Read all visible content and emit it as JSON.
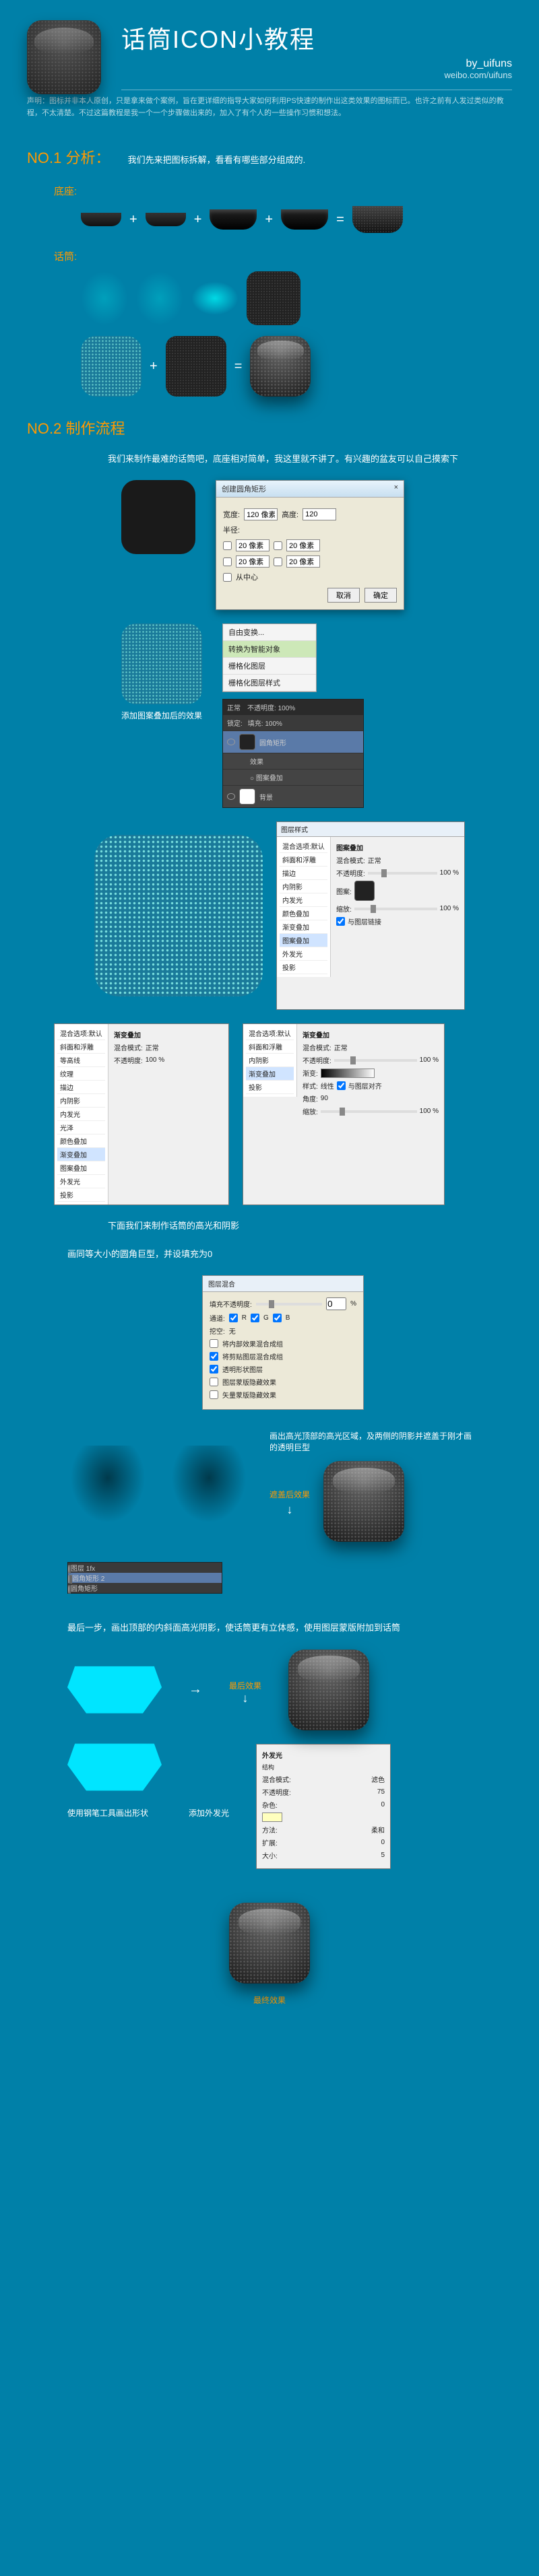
{
  "header": {
    "title": "话筒ICON小教程",
    "author": "by_uifuns",
    "weibo": "weibo.com/uifuns"
  },
  "disclaimer": "声明：图标并非本人原创，只是拿来做个案例，旨在更详细的指导大家如何利用PS快速的制作出这类效果的图标而已。也许之前有人发过类似的教程，不太清楚。不过这篇教程是我一个一个步骤做出来的，加入了有个人的一些操作习惯和想法。",
  "section1": {
    "heading": "NO.1  分析：",
    "sub": "我们先来把图标拆解，看看有哪些部分组成的.",
    "label_base": "底座:",
    "label_mic": "话筒:"
  },
  "section2": {
    "heading": "NO.2 制作流程",
    "desc1": "我们来制作最难的话筒吧，底座相对简单，我这里就不讲了。有兴趣的盆友可以自己摸索下",
    "caption_pattern": "添加图案叠加后的效果",
    "desc2": "下面我们来制作话筒的高光和阴影",
    "desc3": "画同等大小的圆角巨型，并设填充为0",
    "desc4": "画出高光顶部的高光区域，及两侧的阴影并遮盖于刚才画的透明巨型",
    "caption_overlay": "遮盖后效果",
    "desc5": "最后一步，画出顶部的内斜面高光阴影，使话筒更有立体感，使用图层蒙版附加到话筒",
    "caption_final_effect": "最后效果",
    "caption_pen": "使用钢笔工具画出形状",
    "caption_glow": "添加外发光",
    "caption_final": "最终效果"
  },
  "dlg_rrect": {
    "title": "创建圆角矩形",
    "w_label": "宽度:",
    "w_val": "120 像素",
    "h_label": "高度:",
    "h_val": "120",
    "radius_label": "半径:",
    "tl": "20 像素",
    "tr": "20 像素",
    "bl": "20 像素",
    "br": "20 像素",
    "center": "从中心",
    "cancel": "取消",
    "ok": "确定"
  },
  "menu": {
    "i1": "自由变换...",
    "i2": "转换为智能对象",
    "i3": "栅格化图层",
    "i4": "栅格化图层样式"
  },
  "layers": {
    "tab1": "正常",
    "opacity": "不透明度: 100%",
    "lock": "锁定:",
    "fill": "填充: 100%",
    "l1": "圆角矩形",
    "l1_fx": "效果",
    "l1_fx1": "○ 图案叠加",
    "bg": "背景"
  },
  "fx": {
    "title": "图层样式",
    "items": [
      "混合选项:默认",
      "斜面和浮雕",
      "等高线",
      "纹理",
      "描边",
      "内阴影",
      "内发光",
      "光泽",
      "颜色叠加",
      "渐变叠加",
      "图案叠加",
      "外发光",
      "投影"
    ],
    "panel_title": "图案叠加",
    "blend": "混合模式:",
    "blend_v": "正常",
    "opac": "不透明度:",
    "opac_v": "100 %",
    "pat": "图案:",
    "scale": "缩放:",
    "scale_v": "100 %",
    "link": "与图层链接"
  },
  "fx2": {
    "panel_title": "渐变叠加",
    "blend": "混合模式:",
    "blend_v": "正常",
    "opac": "不透明度:",
    "opac_v": "100 %",
    "grad": "渐变:",
    "style": "样式:",
    "style_v": "线性",
    "align": "与图层对齐",
    "angle": "角度:",
    "angle_v": "90",
    "scale": "缩放:",
    "scale_v": "100 %"
  },
  "fill_dlg": {
    "title": "图层混合",
    "fill_opac": "填充不透明度:",
    "fill_v": "0",
    "pct": "%",
    "channels": "通道:",
    "r": "R",
    "g": "G",
    "b": "B",
    "knockout": "挖空:",
    "knockout_v": "无",
    "c1": "将内部效果混合成组",
    "c2": "将剪贴图层混合成组",
    "c3": "透明形状图层",
    "c4": "图层蒙版隐藏效果",
    "c5": "矢量蒙版隐藏效果"
  },
  "layers2": {
    "l1": "图层 1",
    "l2": "圆角矩形 2",
    "l3": "圆角矩形",
    "fx": "fx"
  },
  "glow_dlg": {
    "title": "外发光",
    "struct": "结构",
    "blend": "混合模式:",
    "blend_v": "滤色",
    "opac": "不透明度:",
    "opac_v": "75",
    "noise": "杂色:",
    "noise_v": "0",
    "method": "方法:",
    "method_v": "柔和",
    "spread": "扩展:",
    "spread_v": "0",
    "size": "大小:",
    "size_v": "5"
  },
  "ops": {
    "plus": "+",
    "eq": "="
  }
}
